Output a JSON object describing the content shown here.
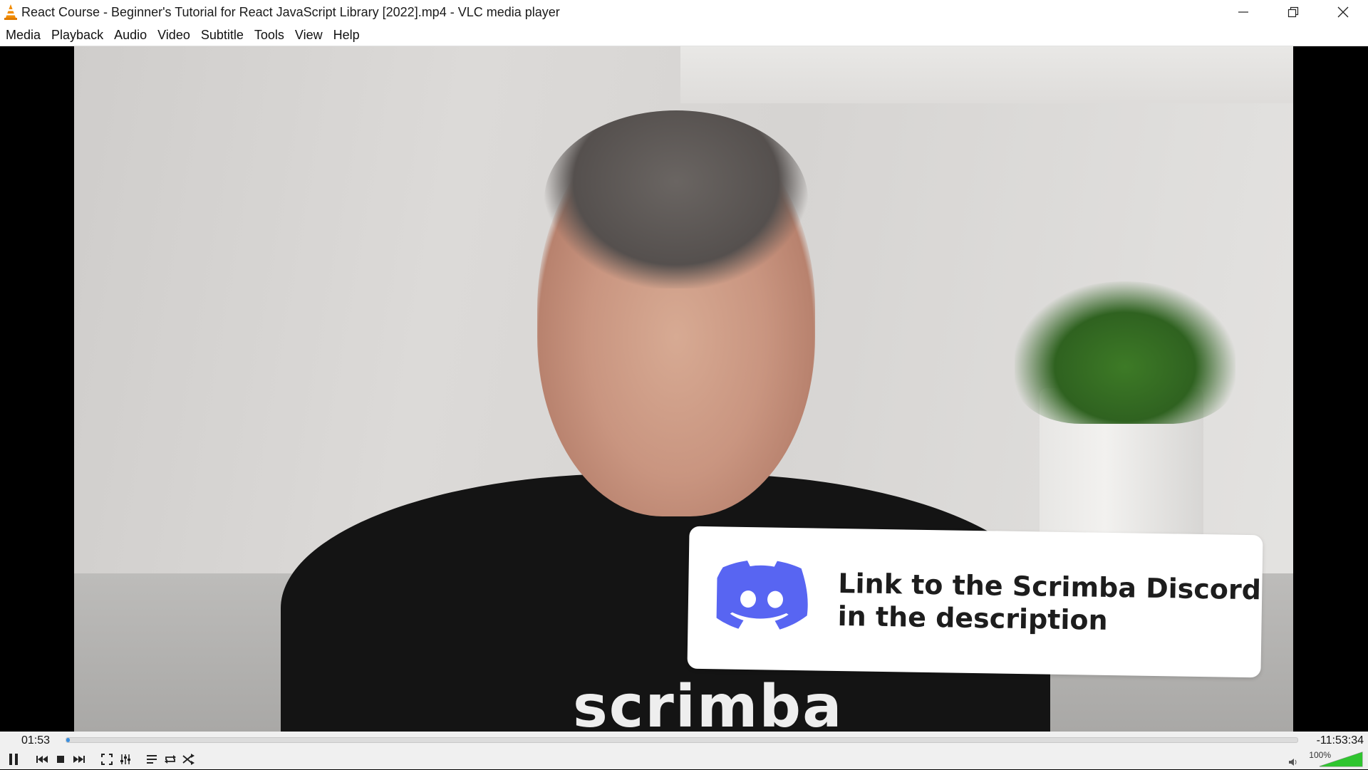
{
  "window": {
    "title": "React Course - Beginner's Tutorial for React JavaScript Library [2022].mp4 - VLC media player"
  },
  "menu": [
    "Media",
    "Playback",
    "Audio",
    "Video",
    "Subtitle",
    "Tools",
    "View",
    "Help"
  ],
  "video": {
    "overlay_line1": "Link to the Scrimba Discord",
    "overlay_line2": "in the description",
    "hoodie_text": "scrimba"
  },
  "playback": {
    "elapsed": "01:53",
    "remaining": "-11:53:34",
    "progress_fraction": 0.003,
    "state": "playing"
  },
  "volume": {
    "label": "100%",
    "level": 1.0
  },
  "colors": {
    "accent": "#3b8ede",
    "volume_green": "#2fc52f",
    "vlc_orange": "#f28c00"
  },
  "icons": {
    "app": "vlc-cone-icon",
    "pause": "pause-icon",
    "previous": "previous-icon",
    "stop": "stop-icon",
    "next": "next-icon",
    "fullscreen": "fullscreen-icon",
    "extended": "extended-settings-icon",
    "playlist": "playlist-icon",
    "loop": "loop-icon",
    "random": "shuffle-icon",
    "speaker": "speaker-icon"
  }
}
